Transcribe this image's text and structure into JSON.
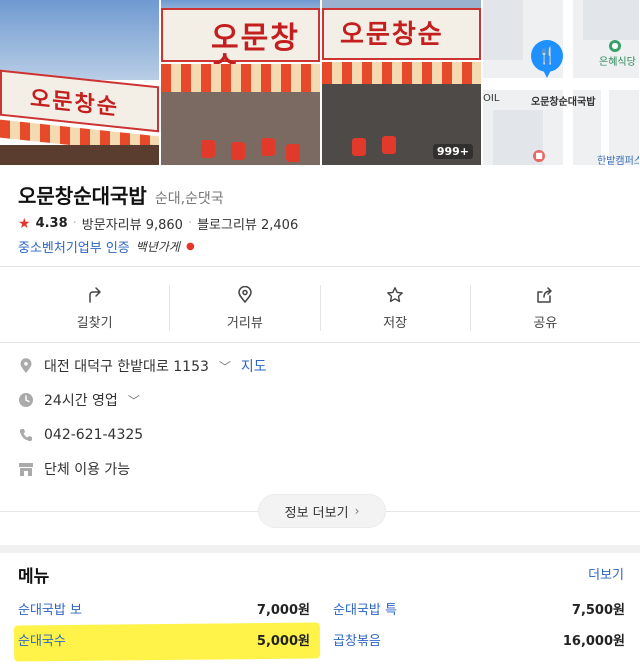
{
  "photos": {
    "sign_text": "오문창순",
    "photo_count": "999+"
  },
  "map": {
    "labels": {
      "top_right": "은혜식당",
      "left": "OIL",
      "place": "오문창순대국밥",
      "bottom_right": "한밭캠퍼스"
    }
  },
  "place": {
    "name": "오문창순대국밥",
    "category": "순대,순댓국",
    "rating": "4.38",
    "visitor_reviews": "방문자리뷰 9,860",
    "blog_reviews": "블로그리뷰 2,406",
    "certification": "중소벤처기업부 인증",
    "certification_mark": "백년가게"
  },
  "actions": [
    {
      "label": "길찾기",
      "icon": "directions-icon"
    },
    {
      "label": "거리뷰",
      "icon": "street-view-pin-icon"
    },
    {
      "label": "저장",
      "icon": "star-outline-icon"
    },
    {
      "label": "공유",
      "icon": "share-icon"
    }
  ],
  "info": {
    "address": "대전 대덕구 한밭대로 1153",
    "map_link": "지도",
    "hours": "24시간 영업",
    "phone": "042-621-4325",
    "group": "단체 이용 가능",
    "more_info": "정보 더보기"
  },
  "menu": {
    "title": "메뉴",
    "more": "더보기",
    "items": [
      {
        "name": "순대국밥 보",
        "price": "7,000원"
      },
      {
        "name": "순대국밥 특",
        "price": "7,500원"
      },
      {
        "name": "순대국수",
        "price": "5,000원"
      },
      {
        "name": "곱창볶음",
        "price": "16,000원"
      }
    ]
  },
  "colors": {
    "accent_blue": "#2d66c4",
    "star_red": "#e5352b",
    "highlight_yellow": "#fff34a"
  }
}
